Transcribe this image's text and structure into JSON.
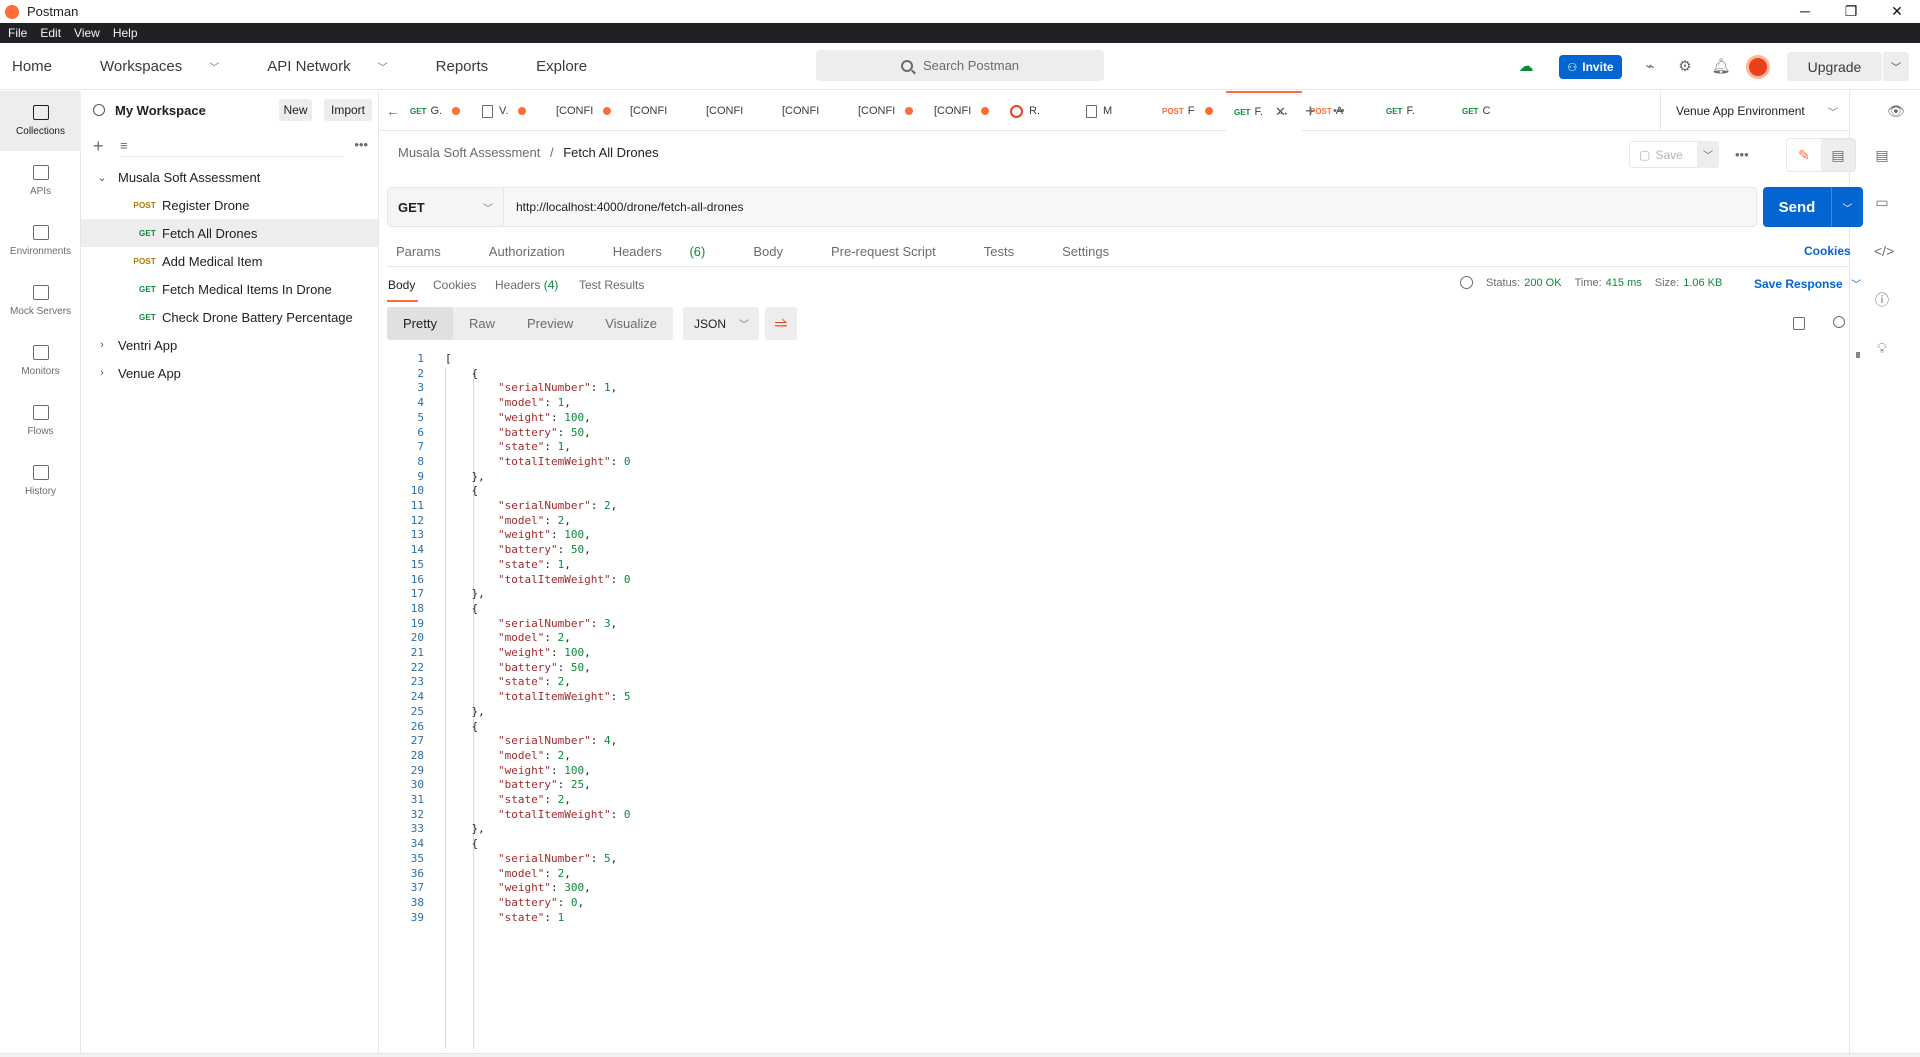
{
  "app": {
    "title": "Postman"
  },
  "window_controls": {
    "minimize": "─",
    "restore": "❐",
    "close": "✕"
  },
  "menu": [
    "File",
    "Edit",
    "View",
    "Help"
  ],
  "header": {
    "nav": [
      {
        "label": "Home",
        "has_caret": false
      },
      {
        "label": "Workspaces",
        "has_caret": true
      },
      {
        "label": "API Network",
        "has_caret": true
      },
      {
        "label": "Reports",
        "has_caret": false
      },
      {
        "label": "Explore",
        "has_caret": false
      }
    ],
    "search_placeholder": "Search Postman",
    "invite_label": "Invite",
    "upgrade_label": "Upgrade"
  },
  "rail": [
    {
      "label": "Collections",
      "icon": "collections-icon",
      "active": true
    },
    {
      "label": "APIs",
      "icon": "apis-icon",
      "active": false
    },
    {
      "label": "Environments",
      "icon": "environments-icon",
      "active": false
    },
    {
      "label": "Mock Servers",
      "icon": "mock-servers-icon",
      "active": false
    },
    {
      "label": "Monitors",
      "icon": "monitors-icon",
      "active": false
    },
    {
      "label": "Flows",
      "icon": "flows-icon",
      "active": false
    },
    {
      "label": "History",
      "icon": "history-icon",
      "active": false
    }
  ],
  "sidebar": {
    "workspace": "My Workspace",
    "new_label": "New",
    "import_label": "Import",
    "tree": [
      {
        "type": "collection",
        "name": "Musala Soft Assessment",
        "expanded": true
      },
      {
        "type": "request",
        "method": "POST",
        "name": "Register Drone",
        "selected": false
      },
      {
        "type": "request",
        "method": "GET",
        "name": "Fetch All Drones",
        "selected": true
      },
      {
        "type": "request",
        "method": "POST",
        "name": "Add Medical Item",
        "selected": false
      },
      {
        "type": "request",
        "method": "GET",
        "name": "Fetch Medical Items In Drone",
        "selected": false
      },
      {
        "type": "request",
        "method": "GET",
        "name": "Check Drone Battery Percentage",
        "selected": false
      },
      {
        "type": "collection",
        "name": "Ventri App",
        "expanded": false
      },
      {
        "type": "collection",
        "name": "Venue App",
        "expanded": false
      }
    ]
  },
  "tabs": [
    {
      "method": "GET",
      "title": "G.",
      "dot": true,
      "icon": ""
    },
    {
      "method": "",
      "title": "V.",
      "dot": true,
      "icon": "doc"
    },
    {
      "method": "",
      "title": "[CONFI",
      "dot": true,
      "icon": ""
    },
    {
      "method": "",
      "title": "[CONFI",
      "dot": false,
      "icon": ""
    },
    {
      "method": "",
      "title": "[CONFI",
      "dot": false,
      "icon": ""
    },
    {
      "method": "",
      "title": "[CONFI",
      "dot": false,
      "icon": ""
    },
    {
      "method": "",
      "title": "[CONFI",
      "dot": true,
      "icon": ""
    },
    {
      "method": "",
      "title": "[CONFI",
      "dot": true,
      "icon": ""
    },
    {
      "method": "",
      "title": "R.",
      "dot": false,
      "icon": "runner"
    },
    {
      "method": "",
      "title": "M",
      "dot": false,
      "icon": "doc"
    },
    {
      "method": "POST",
      "title": "F",
      "dot": true,
      "icon": ""
    },
    {
      "method": "GET",
      "title": "F.",
      "dot": false,
      "icon": "",
      "active": true
    },
    {
      "method": "POST",
      "title": "A",
      "dot": false,
      "icon": ""
    },
    {
      "method": "GET",
      "title": "F.",
      "dot": false,
      "icon": ""
    },
    {
      "method": "GET",
      "title": "C",
      "dot": false,
      "icon": ""
    }
  ],
  "environment": "Venue App Environment",
  "request": {
    "breadcrumb_parent": "Musala Soft Assessment",
    "breadcrumb_current": "Fetch All Drones",
    "save_label": "Save",
    "method": "GET",
    "url": "http://localhost:4000/drone/fetch-all-drones",
    "send_label": "Send",
    "tabs": [
      {
        "label": "Params",
        "count": ""
      },
      {
        "label": "Authorization",
        "count": ""
      },
      {
        "label": "Headers",
        "count": "(6)"
      },
      {
        "label": "Body",
        "count": ""
      },
      {
        "label": "Pre-request Script",
        "count": ""
      },
      {
        "label": "Tests",
        "count": ""
      },
      {
        "label": "Settings",
        "count": ""
      }
    ],
    "cookies_link": "Cookies"
  },
  "response": {
    "tabs": [
      {
        "label": "Body",
        "count": ""
      },
      {
        "label": "Cookies",
        "count": ""
      },
      {
        "label": "Headers",
        "count": "(4)"
      },
      {
        "label": "Test Results",
        "count": ""
      }
    ],
    "status_label": "Status:",
    "status_value": "200 OK",
    "time_label": "Time:",
    "time_value": "415 ms",
    "size_label": "Size:",
    "size_value": "1.06 KB",
    "save_response_label": "Save Response",
    "view_modes": [
      "Pretty",
      "Raw",
      "Preview",
      "Visualize"
    ],
    "format": "JSON",
    "drones": [
      {
        "serialNumber": 1,
        "model": 1,
        "weight": 100,
        "battery": 50,
        "state": 1,
        "totalItemWeight": 0
      },
      {
        "serialNumber": 2,
        "model": 2,
        "weight": 100,
        "battery": 50,
        "state": 1,
        "totalItemWeight": 0
      },
      {
        "serialNumber": 3,
        "model": 2,
        "weight": 100,
        "battery": 50,
        "state": 2,
        "totalItemWeight": 5
      },
      {
        "serialNumber": 4,
        "model": 2,
        "weight": 100,
        "battery": 25,
        "state": 2,
        "totalItemWeight": 0
      },
      {
        "serialNumber": 5,
        "model": 2,
        "weight": 300,
        "battery": 0,
        "state": 1
      }
    ]
  },
  "colors": {
    "accent": "#ff6c37",
    "primary": "#0265d2",
    "get": "#0b8a3b",
    "post": "#ad7a03",
    "json_key": "#a22a2a",
    "json_number": "#0b8a3b",
    "line_number": "#2b6ea8"
  }
}
